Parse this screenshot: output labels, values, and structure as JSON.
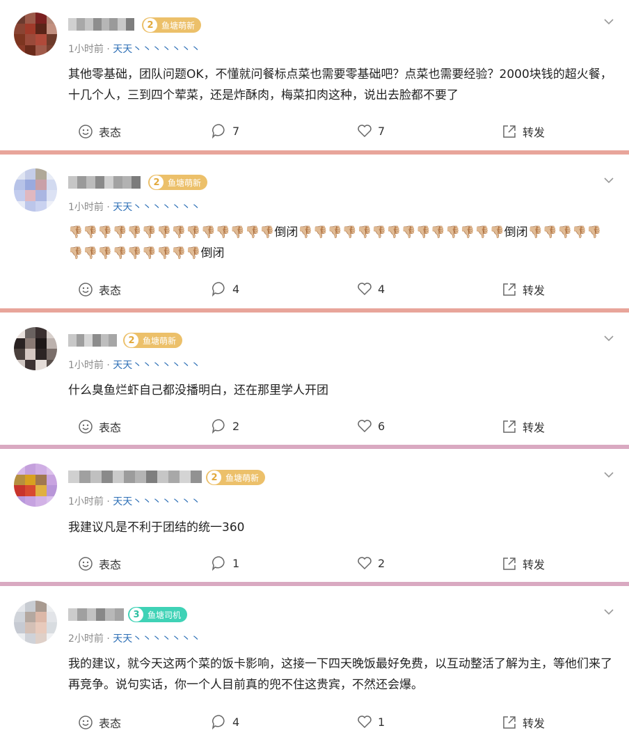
{
  "colors": {
    "separator_a": "#e8a59a",
    "separator_b": "#d9a9c1",
    "link": "#2d6fb6",
    "badge_gold": "#ecc06a",
    "badge_teal": "#3fd2b6"
  },
  "actions": {
    "emoji_label": "表态",
    "share_label": "转发"
  },
  "posts": [
    {
      "time": "1小时前",
      "source": "天天丶丶丶丶丶丶丶",
      "badge": {
        "level": "2",
        "title": "鱼塘萌新",
        "color": "gold"
      },
      "content": "其他零基础，团队问题OK，不懂就问餐标点菜也需要零基础吧？点菜也需要经验？2000块钱的超火餐，十几个人，三到四个荤菜，还是炸酥肉，梅菜扣肉这种，说出去脸都不要了",
      "comments": "7",
      "likes": "7"
    },
    {
      "time": "1小时前",
      "source": "天天丶丶丶丶丶丶丶",
      "badge": {
        "level": "2",
        "title": "鱼塘萌新",
        "color": "gold"
      },
      "content": "👎🏼👎🏼👎🏼👎🏼👎🏼👎🏼👎🏼👎🏼👎🏼👎🏼👎🏼👎🏼👎🏼👎🏼倒闭👎🏼👎🏼👎🏼👎🏼👎🏼👎🏼👎🏼👎🏼👎🏼👎🏼👎🏼👎🏼👎🏼👎🏼倒闭👎🏼👎🏼👎🏼👎🏼👎🏼👎🏼👎🏼👎🏼👎🏼👎🏼👎🏼👎🏼👎🏼👎🏼倒闭",
      "comments": "4",
      "likes": "4"
    },
    {
      "time": "1小时前",
      "source": "天天丶丶丶丶丶丶丶",
      "badge": {
        "level": "2",
        "title": "鱼塘萌新",
        "color": "gold"
      },
      "content": "什么臭鱼烂虾自己都没播明白，还在那里学人开团",
      "comments": "2",
      "likes": "6"
    },
    {
      "time": "1小时前",
      "source": "天天丶丶丶丶丶丶丶",
      "badge": {
        "level": "2",
        "title": "鱼塘萌新",
        "color": "gold"
      },
      "content": "我建议凡是不利于团结的统一360",
      "comments": "1",
      "likes": "2"
    },
    {
      "time": "2小时前",
      "source": "天天丶丶丶丶丶丶丶",
      "badge": {
        "level": "3",
        "title": "鱼塘司机",
        "color": "teal"
      },
      "content": "我的建议，就今天这两个菜的饭卡影响，这接一下四天晚饭最好免费，以互动整活了解为主，等他们来了再竞争。说句实话，你一个人目前真的兜不住这贵宾，不然还会爆。",
      "comments": "4",
      "likes": "1"
    }
  ]
}
